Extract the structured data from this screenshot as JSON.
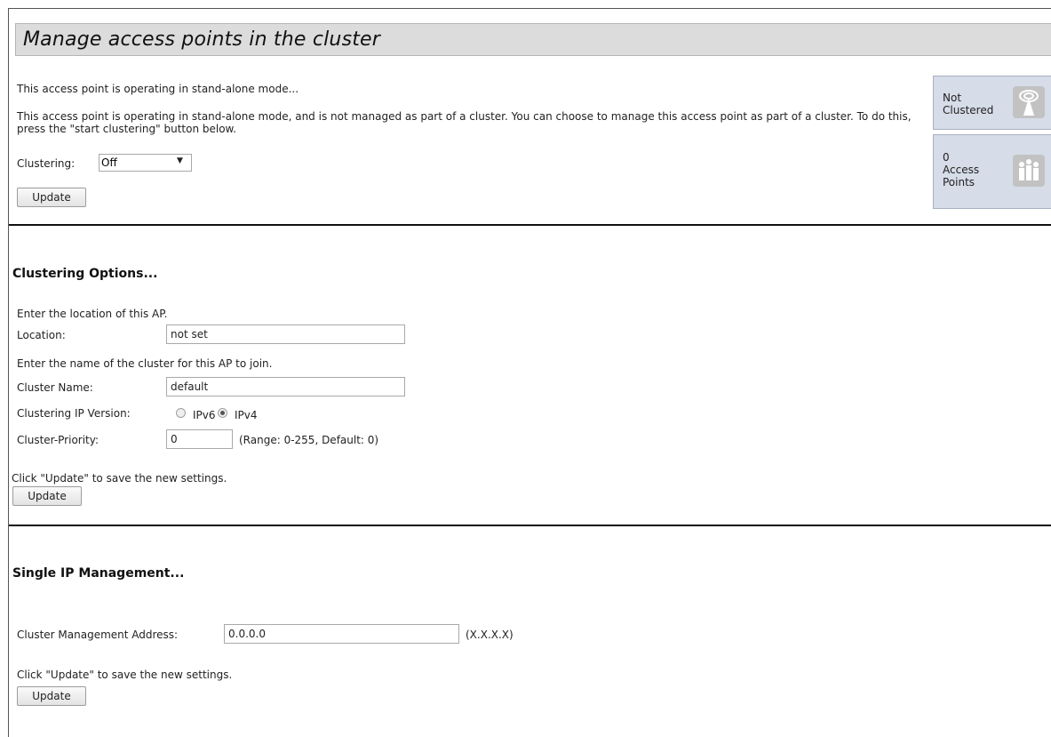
{
  "page_title": "Manage access points in the cluster",
  "intro": {
    "heading_text": "This access point is operating in stand-alone mode...",
    "description": "This access point is operating in stand-alone mode, and is not managed as part of a cluster. You can choose to manage this access point as part of a cluster. To do this, press the \"start clustering\" button below.",
    "clustering_label": "Clustering:",
    "clustering_value": "Off",
    "update_label": "Update"
  },
  "status": {
    "cluster_state": [
      "Not",
      "Clustered"
    ],
    "ap_count": "0",
    "ap_count_label": [
      "Access",
      "Points"
    ],
    "cluster_icon": "antenna-icon",
    "ap_icon": "people-group-icon"
  },
  "clustering_options": {
    "title": "Clustering Options...",
    "location_hint": "Enter the location of this AP.",
    "location_label": "Location:",
    "location_value": "not set",
    "cluster_name_hint": "Enter the name of the cluster for this AP to join.",
    "cluster_name_label": "Cluster Name:",
    "cluster_name_value": "default",
    "ip_version_label": "Clustering IP Version:",
    "ipv6_label": "IPv6",
    "ipv4_label": "IPv4",
    "ip_version_selected": "IPv4",
    "priority_label": "Cluster-Priority:",
    "priority_value": "0",
    "priority_hint": "(Range: 0-255, Default: 0)",
    "save_hint": "Click \"Update\" to save the new settings.",
    "update_label": "Update"
  },
  "single_ip": {
    "title": "Single IP Management...",
    "address_label": "Cluster Management Address:",
    "address_value": "0.0.0.0",
    "address_hint": "(X.X.X.X)",
    "save_hint": "Click \"Update\" to save the new settings.",
    "update_label": "Update"
  }
}
